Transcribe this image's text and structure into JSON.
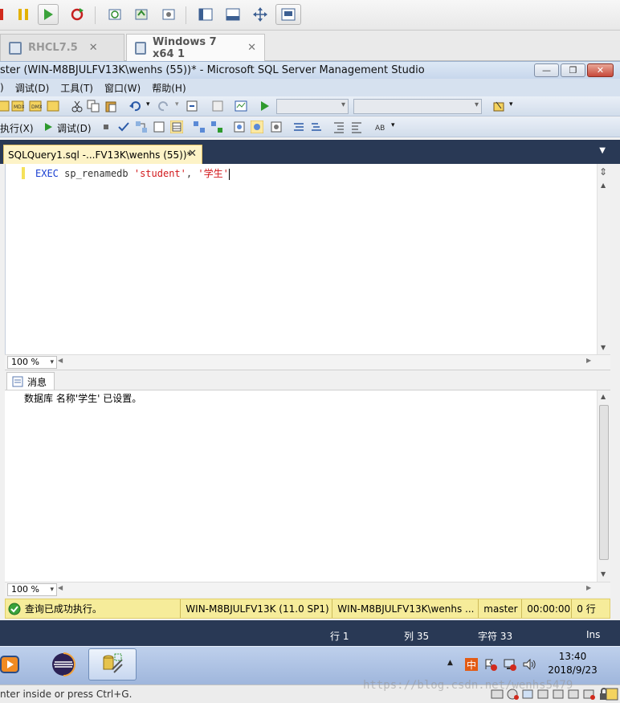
{
  "vm_toolbar": {
    "buttons": [
      "stop-icon",
      "pause-icon",
      "play-icon",
      "restart-icon",
      "snapshot-icon",
      "revert-snapshot-icon",
      "snapshot-manager-icon",
      "sidebar-icon",
      "thumbnail-icon",
      "fullscreen-icon",
      "console-view-icon"
    ]
  },
  "vm_tabs": [
    {
      "label": "RHCL7.5",
      "close": "✕"
    },
    {
      "label": "Windows 7 x64 1",
      "close": "✕"
    }
  ],
  "ssms": {
    "title": "ster (WIN-M8BJULFV13K\\wenhs (55))* - Microsoft SQL Server Management Studio",
    "window_controls": {
      "minimize": "—",
      "restore": "❐",
      "close": "✕"
    },
    "menu": [
      ")",
      "调试(D)",
      "工具(T)",
      "窗口(W)",
      "帮助(H)"
    ],
    "toolbar2": {
      "execute": "执行(X)",
      "debug": "调试(D)"
    },
    "doc_tab": {
      "label": "SQLQuery1.sql -...FV13K\\wenhs (55))*",
      "close": "✕"
    },
    "editor": {
      "code": {
        "keyword": "EXEC",
        "proc": "sp_renamedb",
        "arg1": "'student'",
        "comma": ",",
        "arg2": "'学生'"
      },
      "zoom": "100 %"
    },
    "results": {
      "tab_label": "消息",
      "message": "数据库 名称'学生' 已设置。",
      "zoom": "100 %"
    },
    "query_status": {
      "message": "查询已成功执行。",
      "server": "WIN-M8BJULFV13K (11.0 SP1)",
      "user": "WIN-M8BJULFV13K\\wenhs ...",
      "database": "master",
      "elapsed": "00:00:00",
      "rows": "0 行"
    },
    "status_bar": {
      "line": "行 1",
      "col": "列 35",
      "char": "字符 33",
      "mode": "Ins"
    }
  },
  "taskbar": {
    "clock_time": "13:40",
    "clock_date": "2018/9/23"
  },
  "vm_status": {
    "hint": "nter inside or press Ctrl+G."
  },
  "watermark": "https://blog.csdn.net/wenhs5479",
  "colors": {
    "accent_dark": "#293955",
    "tab_active": "#fdf3c7",
    "status_ok": "#f6ec9a",
    "keyword": "#1a3fd1",
    "string": "#d2191c"
  }
}
